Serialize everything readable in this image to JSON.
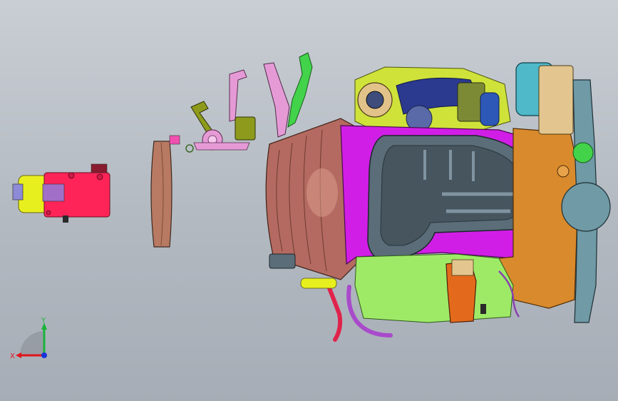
{
  "viewport": {
    "background_top": "#c9ced4",
    "background_bottom": "#a7adb6"
  },
  "triad": {
    "x_label": "X",
    "y_label": "Y",
    "x_color": "#e0161b",
    "y_color": "#18b43a",
    "z_color": "#1a34d8"
  },
  "model": {
    "colors": {
      "bellhousing": "#b46a60",
      "oil_pan": "#5a6d78",
      "block_magenta": "#d11ee6",
      "starter_red": "#ff2458",
      "starter_yellow": "#e8ef1e",
      "flywheel": "#b87a62",
      "alternator_teal": "#4fb8c9",
      "front_cover_orange": "#d98a2c",
      "lower_green": "#9eea67",
      "pulley_slate": "#6f9aa6",
      "bracket_green": "#42d34a",
      "bracket_pink": "#e59ad6",
      "shift_olive": "#8d9a1c",
      "mount_orange": "#e36a1c"
    }
  }
}
